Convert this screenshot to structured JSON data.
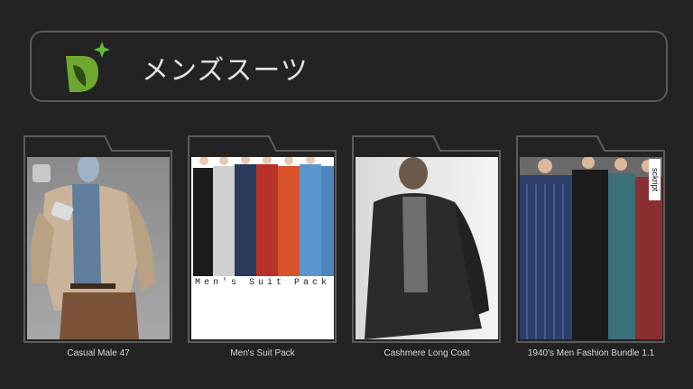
{
  "header": {
    "title": "メンズスーツ",
    "logo_icon": "leaf-sparkle-logo"
  },
  "colors": {
    "background": "#232323",
    "border": "#5a5a5a",
    "accent_green": "#7cc142",
    "sparkle_green": "#5fba3a"
  },
  "products": [
    {
      "name": "Casual Male 47",
      "icon": "daz-badge-icon"
    },
    {
      "name": "Men's Suit Pack",
      "caption": "Men's Suit Pack"
    },
    {
      "name": "Cashmere Long Coat"
    },
    {
      "name": "1940's Men Fashion Bundle 1.1",
      "badge": "sckript"
    }
  ]
}
